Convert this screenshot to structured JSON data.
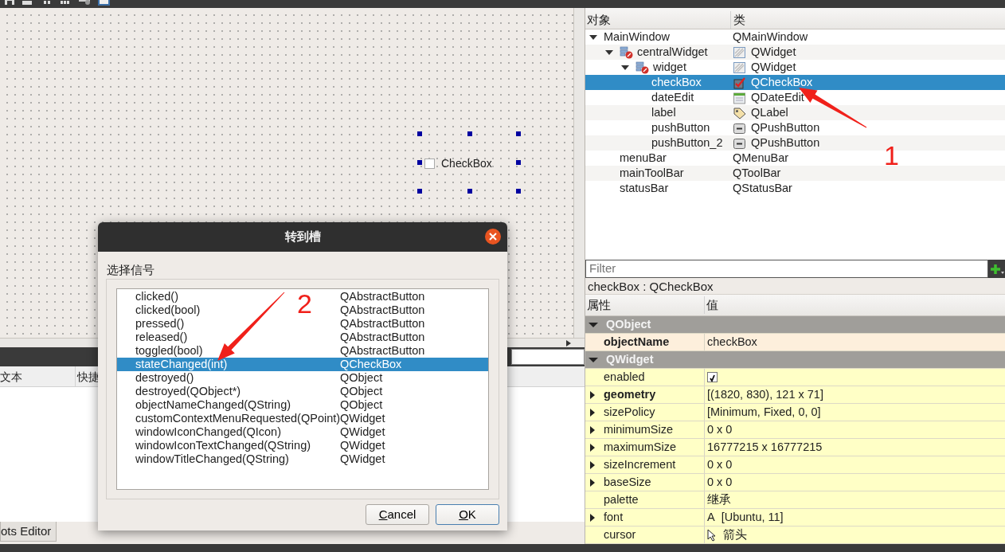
{
  "canvas": {
    "checkbox": {
      "label": "CheckBox",
      "checked": false,
      "selected": true
    }
  },
  "bottom_dock": {
    "columns": [
      "文本",
      "快捷"
    ],
    "tab": {
      "label": "ots Editor",
      "selected": true
    }
  },
  "object_tree": {
    "columns": [
      "对象",
      "类"
    ],
    "rows": [
      {
        "name": "MainWindow",
        "class": "QMainWindow",
        "expanded": true,
        "selected": false,
        "children": [
          {
            "name": "centralWidget",
            "class": "QWidget",
            "icon": {
              "kind": "container"
            },
            "class_icon": {
              "kind": "widget"
            },
            "expanded": true,
            "selected": false,
            "children": [
              {
                "name": "widget",
                "class": "QWidget",
                "icon": {
                  "kind": "container"
                },
                "class_icon": {
                  "kind": "widget"
                },
                "expanded": true,
                "selected": false,
                "children": [
                  {
                    "name": "checkBox",
                    "class": "QCheckBox",
                    "class_icon": {
                      "kind": "checkbox"
                    },
                    "selected": true
                  },
                  {
                    "name": "dateEdit",
                    "class": "QDateEdit",
                    "class_icon": {
                      "kind": "date"
                    },
                    "selected": false
                  },
                  {
                    "name": "label",
                    "class": "QLabel",
                    "class_icon": {
                      "kind": "label"
                    },
                    "selected": false
                  },
                  {
                    "name": "pushButton",
                    "class": "QPushButton",
                    "class_icon": {
                      "kind": "button"
                    },
                    "selected": false
                  },
                  {
                    "name": "pushButton_2",
                    "class": "QPushButton",
                    "class_icon": {
                      "kind": "button"
                    },
                    "selected": false
                  }
                ]
              }
            ]
          },
          {
            "name": "menuBar",
            "class": "QMenuBar",
            "selected": false
          },
          {
            "name": "mainToolBar",
            "class": "QToolBar",
            "selected": false
          },
          {
            "name": "statusBar",
            "class": "QStatusBar",
            "selected": false
          }
        ]
      }
    ]
  },
  "filter": {
    "placeholder": "Filter"
  },
  "current_object": "checkBox : QCheckBox",
  "properties": {
    "columns": [
      "属性",
      "值"
    ],
    "groups": [
      {
        "name": "QObject",
        "expanded": true,
        "color": "#fdefdc",
        "rows": [
          {
            "name": "objectName",
            "value": "checkBox",
            "bold": true,
            "expandable": false
          }
        ]
      },
      {
        "name": "QWidget",
        "expanded": true,
        "color": "#ffffc6",
        "rows": [
          {
            "name": "enabled",
            "kind": "checkbox",
            "checked": true,
            "bold": false,
            "expandable": false
          },
          {
            "name": "geometry",
            "value": "[(1820, 830), 121 x 71]",
            "bold": true,
            "expandable": true
          },
          {
            "name": "sizePolicy",
            "value": "[Minimum, Fixed, 0, 0]",
            "bold": false,
            "expandable": true
          },
          {
            "name": "minimumSize",
            "value": "0 x 0",
            "bold": false,
            "expandable": true
          },
          {
            "name": "maximumSize",
            "value": "16777215 x 16777215",
            "bold": false,
            "expandable": true
          },
          {
            "name": "sizeIncrement",
            "value": "0 x 0",
            "bold": false,
            "expandable": true
          },
          {
            "name": "baseSize",
            "value": "0 x 0",
            "bold": false,
            "expandable": true
          },
          {
            "name": "palette",
            "value": "继承",
            "bold": false,
            "expandable": false
          },
          {
            "name": "font",
            "kind": "font",
            "sample": "A",
            "value": "[Ubuntu, 11]",
            "bold": false,
            "expandable": true
          },
          {
            "name": "cursor",
            "kind": "cursor",
            "value": "箭头",
            "bold": false,
            "expandable": false
          }
        ]
      }
    ]
  },
  "dialog": {
    "title": "转到槽",
    "group_label": "选择信号",
    "signals": [
      {
        "signal": "clicked()",
        "class": "QAbstractButton",
        "selected": false
      },
      {
        "signal": "clicked(bool)",
        "class": "QAbstractButton",
        "selected": false
      },
      {
        "signal": "pressed()",
        "class": "QAbstractButton",
        "selected": false
      },
      {
        "signal": "released()",
        "class": "QAbstractButton",
        "selected": false
      },
      {
        "signal": "toggled(bool)",
        "class": "QAbstractButton",
        "selected": false
      },
      {
        "signal": "stateChanged(int)",
        "class": "QCheckBox",
        "selected": true
      },
      {
        "signal": "destroyed()",
        "class": "QObject",
        "selected": false
      },
      {
        "signal": "destroyed(QObject*)",
        "class": "QObject",
        "selected": false
      },
      {
        "signal": "objectNameChanged(QString)",
        "class": "QObject",
        "selected": false
      },
      {
        "signal": "customContextMenuRequested(QPoint)",
        "class": "QWidget",
        "selected": false
      },
      {
        "signal": "windowIconChanged(QIcon)",
        "class": "QWidget",
        "selected": false
      },
      {
        "signal": "windowIconTextChanged(QString)",
        "class": "QWidget",
        "selected": false
      },
      {
        "signal": "windowTitleChanged(QString)",
        "class": "QWidget",
        "selected": false
      }
    ],
    "buttons": [
      {
        "label": "Cancel",
        "default": false,
        "underline_first": true
      },
      {
        "label": "OK",
        "default": true,
        "underline_first": true
      }
    ]
  },
  "annotations": [
    {
      "text": "1"
    },
    {
      "text": "2"
    }
  ]
}
